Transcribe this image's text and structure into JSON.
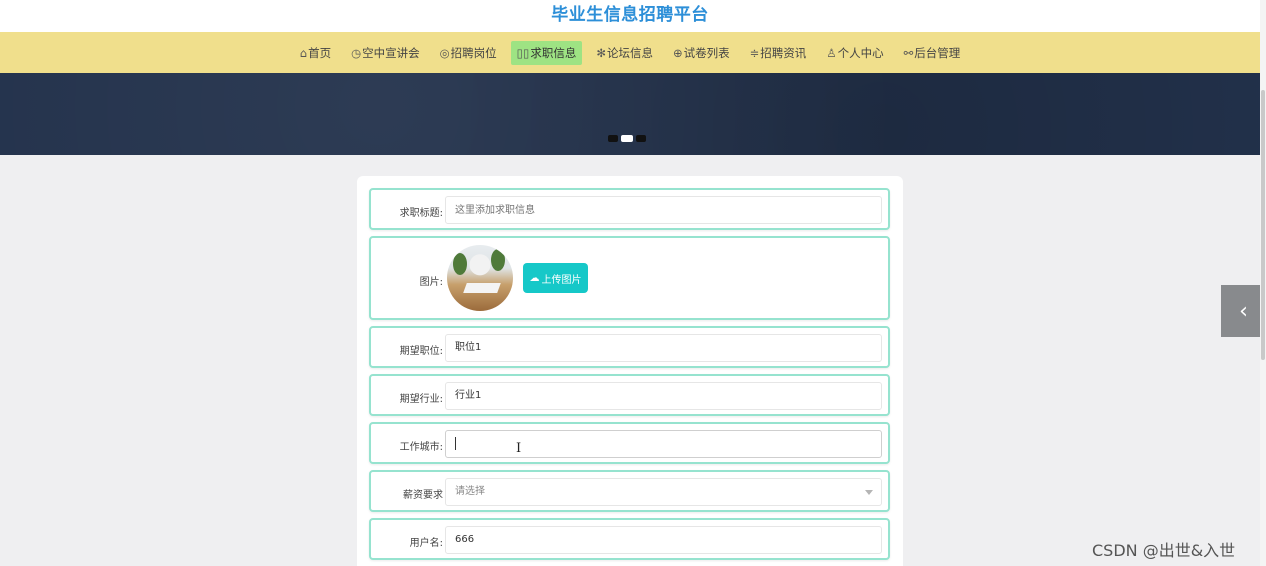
{
  "site": {
    "title": "毕业生信息招聘平台"
  },
  "nav": [
    {
      "icon": "home-icon",
      "glyph": "⌂",
      "label": "首页"
    },
    {
      "icon": "clock-icon",
      "glyph": "◷",
      "label": "空中宣讲会"
    },
    {
      "icon": "compass-icon",
      "glyph": "◎",
      "label": "招聘岗位"
    },
    {
      "icon": "doc-icon",
      "glyph": "▯▯",
      "label": "求职信息",
      "active": true
    },
    {
      "icon": "asterisk-icon",
      "glyph": "✻",
      "label": "论坛信息"
    },
    {
      "icon": "globe-icon",
      "glyph": "⊕",
      "label": "试卷列表"
    },
    {
      "icon": "list-icon",
      "glyph": "≑",
      "label": "招聘资讯"
    },
    {
      "icon": "user-icon",
      "glyph": "♙",
      "label": "个人中心"
    },
    {
      "icon": "link-icon",
      "glyph": "⚯",
      "label": "后台管理"
    }
  ],
  "form": {
    "title_label": "求职标题:",
    "title_placeholder": "这里添加求职信息",
    "image_label": "图片:",
    "upload_label": "上传图片",
    "position_label": "期望职位:",
    "position_value": "职位1",
    "industry_label": "期望行业:",
    "industry_value": "行业1",
    "city_label": "工作城市:",
    "city_value": "",
    "salary_label": "薪资要求",
    "salary_placeholder": "请选择",
    "username_label": "用户名:",
    "username_value": "666"
  },
  "watermark": "CSDN @出世&入世",
  "colors": {
    "nav_bg": "#f0df8c",
    "active_nav": "#9ee383",
    "title": "#2d8fd8",
    "row_border": "#96e3cf",
    "upload_btn": "#16c8c8"
  }
}
